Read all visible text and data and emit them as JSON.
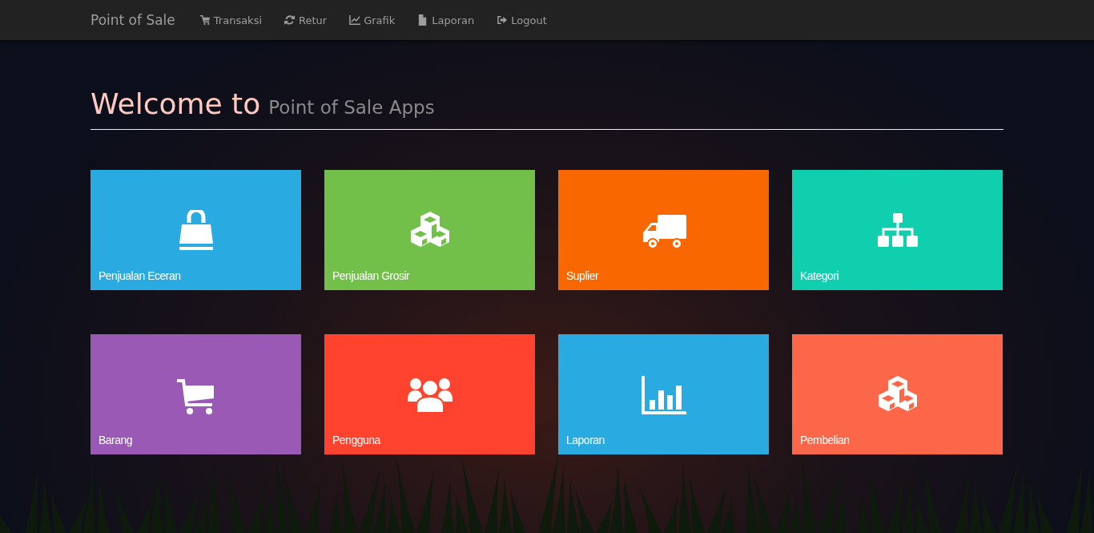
{
  "navbar": {
    "brand": "Point of Sale",
    "items": [
      {
        "kind": "cart",
        "label": "Transaksi"
      },
      {
        "kind": "refresh",
        "label": "Retur"
      },
      {
        "kind": "chart",
        "label": "Grafik"
      },
      {
        "kind": "file",
        "label": "Laporan"
      },
      {
        "kind": "logout",
        "label": "Logout"
      }
    ]
  },
  "heading": {
    "title": "Welcome to",
    "subtitle": "Point of Sale Apps"
  },
  "tiles": [
    {
      "kind": "bag",
      "label": "Penjualan Eceran",
      "color": "#29abe2"
    },
    {
      "kind": "cubes",
      "label": "Penjualan Grosir",
      "color": "#72c04a"
    },
    {
      "kind": "truck",
      "label": "Suplier",
      "color": "#f96800"
    },
    {
      "kind": "sitemap",
      "label": "Kategori",
      "color": "#10cfae"
    },
    {
      "kind": "cart",
      "label": "Barang",
      "color": "#9b59b6"
    },
    {
      "kind": "users",
      "label": "Pengguna",
      "color": "#ff432e"
    },
    {
      "kind": "barchart",
      "label": "Laporan",
      "color": "#29abe2"
    },
    {
      "kind": "cubes",
      "label": "Pembelian",
      "color": "#fc6749"
    }
  ]
}
